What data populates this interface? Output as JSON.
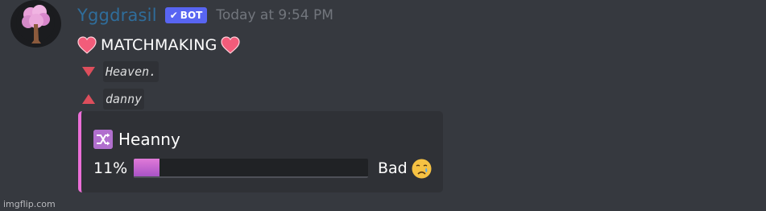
{
  "message": {
    "author": "Yggdrasil",
    "bot_badge": "BOT",
    "timestamp": "Today at 9:54 PM",
    "title": "MATCHMAKING",
    "player_one": "Heaven.",
    "player_two": "danny"
  },
  "embed": {
    "title": "Heanny",
    "percent_label": "11%",
    "percent_value": 0.11,
    "verdict": "Bad",
    "accent_color": "#ec6fd8"
  },
  "icons": {
    "avatar": "pink-tree-avatar",
    "badge": "check-icon",
    "title": "heart-icon",
    "player_one": "red-triangle-down-icon",
    "player_two": "red-triangle-up-icon",
    "embed": "shuffle-icon",
    "verdict": "crying-face-icon"
  },
  "colors": {
    "background": "#36393f",
    "username": "#2f6d9b",
    "bot_badge": "#5865f2",
    "embed_background": "#2f3136",
    "progress_fill": "#d06ad5"
  },
  "watermark": "imgflip.com"
}
